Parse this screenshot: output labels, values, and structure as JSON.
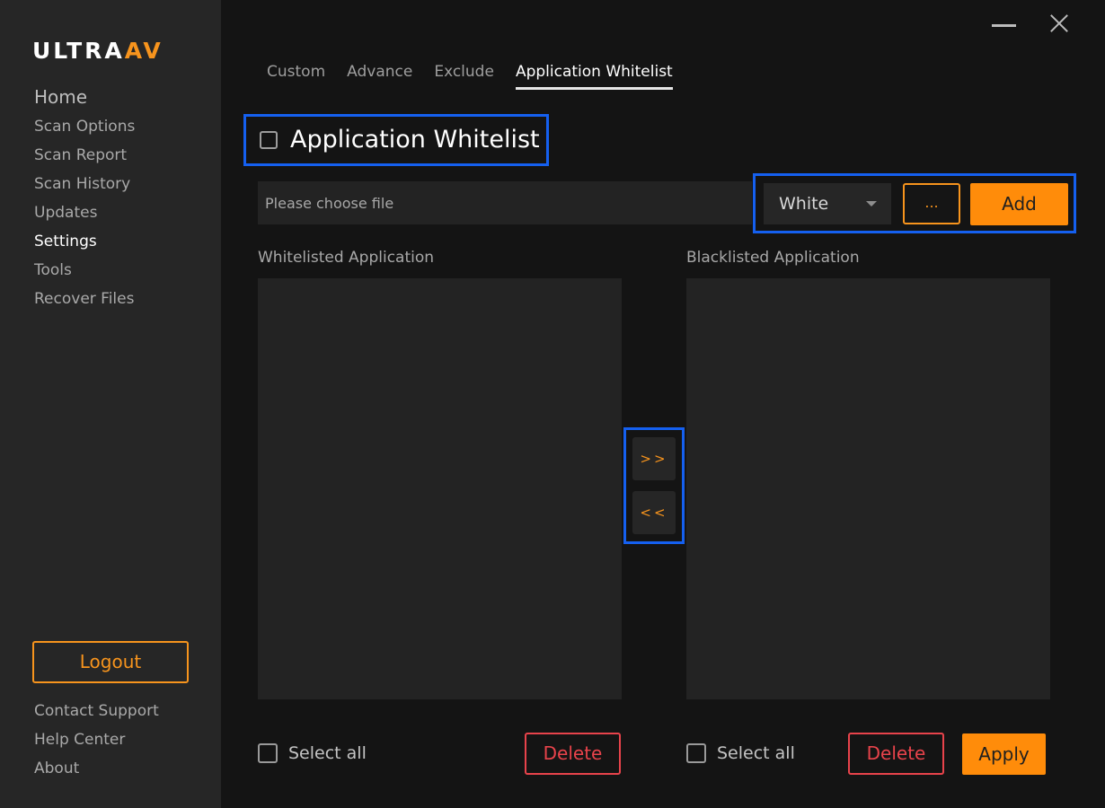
{
  "app": {
    "logo_main": "ULTRA",
    "logo_accent": "AV"
  },
  "sidebar": {
    "items": [
      {
        "label": "Home"
      },
      {
        "label": "Scan Options"
      },
      {
        "label": "Scan Report"
      },
      {
        "label": "Scan History"
      },
      {
        "label": "Updates"
      },
      {
        "label": "Settings",
        "active": true
      },
      {
        "label": "Tools"
      },
      {
        "label": "Recover Files"
      }
    ],
    "logout_label": "Logout",
    "footer": [
      {
        "label": "Contact Support"
      },
      {
        "label": "Help Center"
      },
      {
        "label": "About"
      }
    ]
  },
  "window_controls": {
    "minimize_icon": "minimize-icon",
    "close_icon": "close-icon"
  },
  "tabs": [
    {
      "label": "Custom"
    },
    {
      "label": "Advance"
    },
    {
      "label": "Exclude"
    },
    {
      "label": "Application Whitelist",
      "active": true
    }
  ],
  "section": {
    "title": "Application Whitelist",
    "checked": false
  },
  "file_picker": {
    "placeholder": "Please choose file",
    "value": "",
    "list_type_selected": "White",
    "browse_label": "...",
    "add_label": "Add"
  },
  "whitelist": {
    "label": "Whitelisted Application",
    "items": [],
    "select_all_label": "Select all",
    "delete_label": "Delete"
  },
  "blacklist": {
    "label": "Blacklisted Application",
    "items": [],
    "select_all_label": "Select all",
    "delete_label": "Delete"
  },
  "move": {
    "to_blacklist_label": ">>",
    "to_whitelist_label": "<<"
  },
  "apply_label": "Apply",
  "colors": {
    "accent": "#f7941d",
    "danger": "#e8434b",
    "highlight": "#1560f0",
    "background": "#141414",
    "sidebar": "#262626"
  }
}
